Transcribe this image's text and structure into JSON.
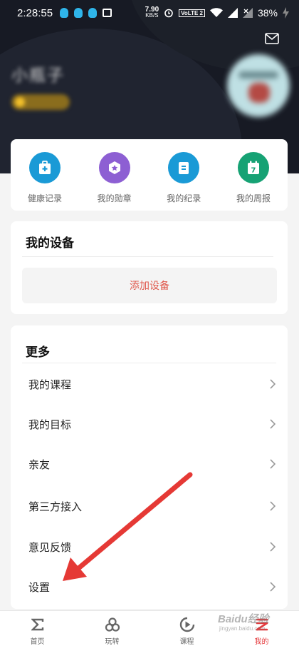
{
  "status_bar": {
    "time": "2:28:55",
    "net_speed_value": "7.90",
    "net_speed_unit": "KB/S",
    "volte": "VoLTE 2",
    "battery": "38%"
  },
  "profile": {
    "username": "小瓶子",
    "mail_icon": "mail-icon"
  },
  "quick_actions": [
    {
      "label": "健康记录",
      "icon": "medical-kit-icon",
      "color": "#1a9ad6"
    },
    {
      "label": "我的勋章",
      "icon": "medal-icon",
      "color": "#8d5fd3"
    },
    {
      "label": "我的纪录",
      "icon": "record-icon",
      "color": "#1a9ad6"
    },
    {
      "label": "我的周报",
      "icon": "calendar-icon",
      "color": "#16a274"
    }
  ],
  "calendar_day": "7",
  "devices": {
    "title": "我的设备",
    "add_button": "添加设备"
  },
  "more": {
    "title": "更多",
    "items": [
      {
        "label": "我的课程"
      },
      {
        "label": "我的目标"
      },
      {
        "label": "亲友"
      },
      {
        "label": "第三方接入"
      },
      {
        "label": "意见反馈"
      },
      {
        "label": "设置"
      }
    ]
  },
  "tabbar": {
    "items": [
      {
        "label": "首页",
        "icon": "sigma-icon"
      },
      {
        "label": "玩转",
        "icon": "explore-icon"
      },
      {
        "label": "课程",
        "icon": "play-icon"
      },
      {
        "label": "我的",
        "icon": "me-icon",
        "active": true
      }
    ]
  },
  "colors": {
    "accent": "#e4393c",
    "header_bg": "#171a24",
    "add_device_text": "#e05a4e",
    "annotation_arrow": "#e53935"
  },
  "watermark": {
    "name": "Baidu经验",
    "url": "jingyan.baidu.com"
  }
}
